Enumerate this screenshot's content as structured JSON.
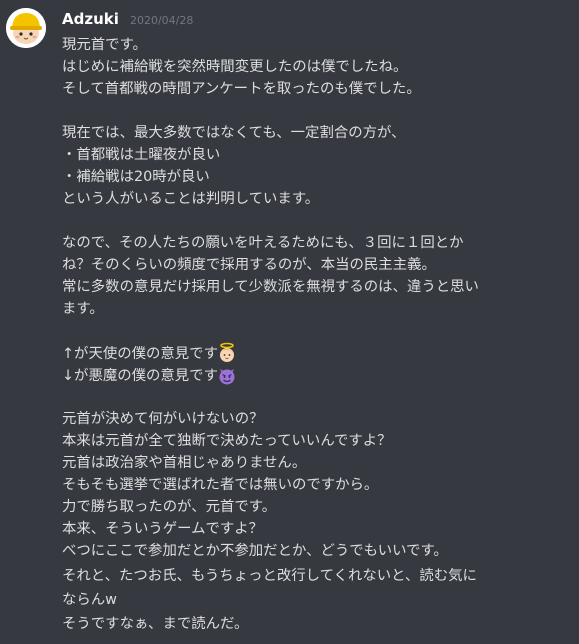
{
  "message": {
    "author": "Adzuki",
    "timestamp": "2020/04/28",
    "avatar_icon": "hardhat-character-icon",
    "lines": [
      "現元首です。",
      "はじめに補給戦を突然時間変更したのは僕でしたね。",
      "そして首都戦の時間アンケートを取ったのも僕でした。",
      "",
      "現在では、最大多数ではなくても、一定割合の方が、",
      "・首都戦は土曜夜が良い",
      "・補給戦は20時が良い",
      "という人がいることは判明しています。",
      "",
      "なので、その人たちの願いを叶えるためにも、３回に１回とか",
      "ね？そのくらいの頻度で採用するのが、本当の民主主義。",
      "常に多数の意見だけ採用して少数派を無視するのは、違うと思い",
      "ます。",
      ""
    ],
    "angel_line": "↑が天使の僕の意見です",
    "angel_icon": "angel-emoji-icon",
    "devil_line": "↓が悪魔の僕の意見です",
    "devil_icon": "smiling-imp-emoji-icon",
    "lines_after": [
      "",
      "元首が決めて何がいけないの？",
      "本来は元首が全て独断で決めたっていいんですよ？",
      "元首は政治家や首相じゃありません。",
      "そもそも選挙で選ばれた者では無いのですから。",
      "力で勝ち取ったのが、元首です。",
      "本来、そういうゲームですよ？",
      "べつにここで参加だとか不参加だとか、どうでもいいです。"
    ]
  },
  "followups": [
    {
      "lines": [
        "それと、たつお氏、もうちょっと改行してくれないと、読む気に",
        "ならんw"
      ]
    },
    {
      "lines": [
        "そうですなぁ、まで読んだ。"
      ]
    }
  ]
}
